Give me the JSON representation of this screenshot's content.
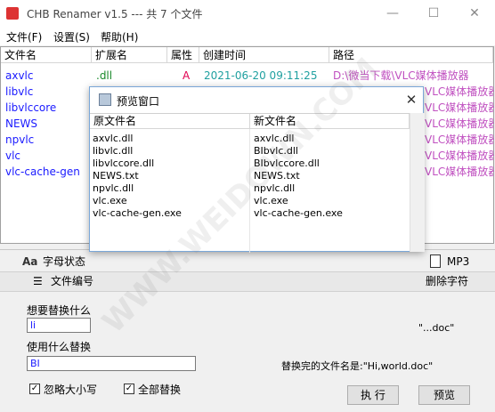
{
  "window": {
    "title": "CHB Renamer v1.5 --- 共 7 个文件",
    "minimize_icon": "—",
    "maximize_icon": "☐",
    "close_icon": "✕"
  },
  "menu": [
    "文件(F)",
    "设置(S)",
    "帮助(H)"
  ],
  "list": {
    "columns": [
      "文件名",
      "扩展名",
      "属性",
      "创建时间",
      "路径"
    ],
    "rows": [
      {
        "name": "axvlc",
        "ext": ".dll",
        "attr": "A",
        "time": "2021-06-20 09:11:25",
        "path": "D:\\微当下载\\VLC媒体播放器"
      },
      {
        "name": "libvlc",
        "path": "VLC媒体播放器"
      },
      {
        "name": "libvlccore",
        "path": "VLC媒体播放器"
      },
      {
        "name": "NEWS",
        "path": "VLC媒体播放器"
      },
      {
        "name": "npvlc",
        "path": "VLC媒体播放器"
      },
      {
        "name": "vlc",
        "path": "VLC媒体播放器"
      },
      {
        "name": "vlc-cache-gen",
        "path": "VLC媒体播放器"
      }
    ]
  },
  "panel": {
    "tab_case": "字母状态",
    "tab_case_icon": "Aa",
    "tab_mp3": "MP3",
    "tab_number": "文件编号",
    "tab_delete": "删除字符",
    "find_label": "想要替换什么",
    "find_value": "li",
    "replace_label": "使用什么替换",
    "replace_value": "BI",
    "preview_before": "\"...doc\"",
    "preview_after_label": "替换完的文件名是:\"Hi,world.doc\"",
    "ignore_case": "忽略大小写",
    "replace_all": "全部替换",
    "execute_button": "执 行",
    "preview_button": "预览"
  },
  "dialog": {
    "title": "预览窗口",
    "col_old": "原文件名",
    "col_new": "新文件名",
    "rows": [
      {
        "old": "axvlc.dll",
        "new": "axvlc.dll"
      },
      {
        "old": "libvlc.dll",
        "new": "BIbvlc.dll"
      },
      {
        "old": "libvlccore.dll",
        "new": "BIbvlccore.dll"
      },
      {
        "old": "NEWS.txt",
        "new": "NEWS.txt"
      },
      {
        "old": "npvlc.dll",
        "new": "npvlc.dll"
      },
      {
        "old": "vlc.exe",
        "new": "vlc.exe"
      },
      {
        "old": "vlc-cache-gen.exe",
        "new": "vlc-cache-gen.exe"
      }
    ]
  },
  "watermark": "WWW.WEIDOWN.COM"
}
